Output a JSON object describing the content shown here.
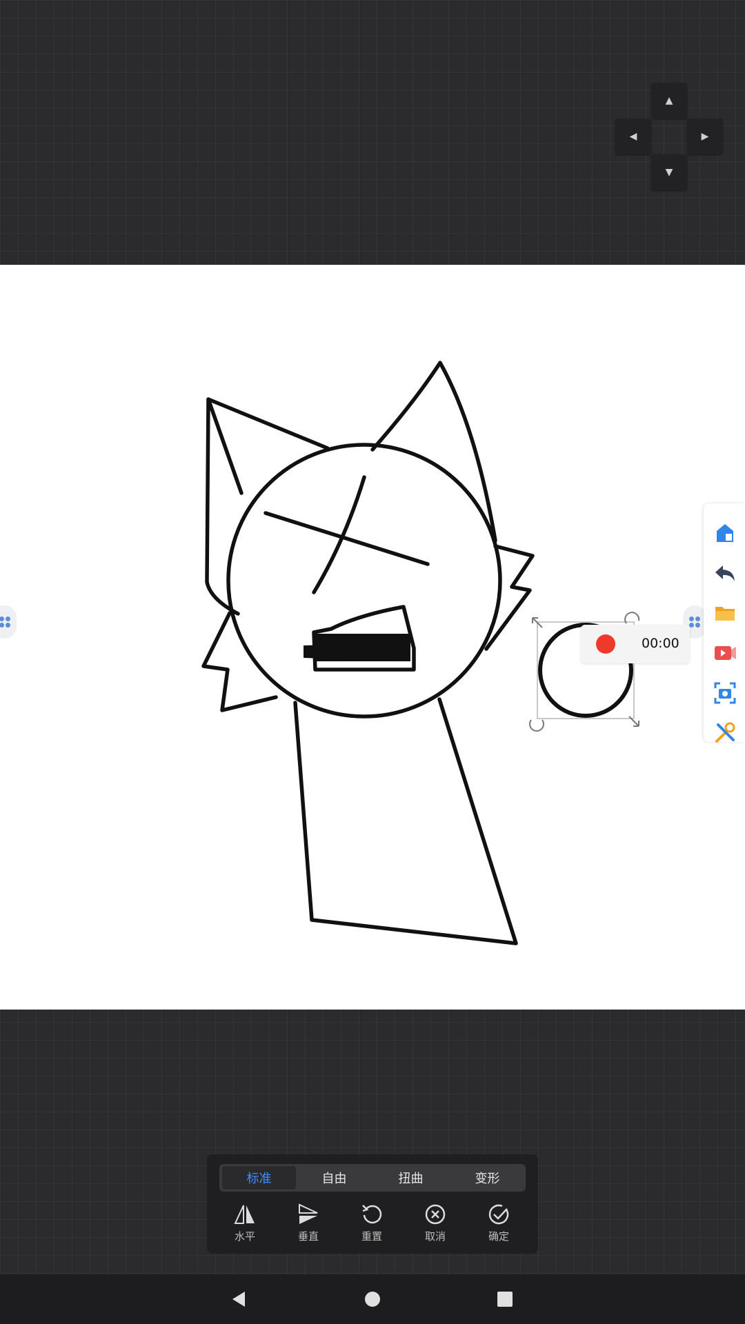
{
  "dpad": {
    "up": "▲",
    "left": "◀",
    "right": "▶",
    "down": "▼"
  },
  "recorder": {
    "time": "00:00",
    "dot_color": "#ee3a2a"
  },
  "right_toolbar": {
    "items": [
      {
        "name": "home-icon"
      },
      {
        "name": "back-arrow-icon"
      },
      {
        "name": "folder-icon"
      },
      {
        "name": "video-record-icon"
      },
      {
        "name": "screenshot-icon"
      },
      {
        "name": "tools-icon"
      }
    ]
  },
  "transform_panel": {
    "tabs": [
      "标准",
      "自由",
      "扭曲",
      "变形"
    ],
    "active_tab": "标准",
    "actions": [
      {
        "label": "水平",
        "icon": "flip-horizontal-icon"
      },
      {
        "label": "垂直",
        "icon": "flip-vertical-icon"
      },
      {
        "label": "重置",
        "icon": "reset-icon"
      },
      {
        "label": "取消",
        "icon": "cancel-icon"
      },
      {
        "label": "确定",
        "icon": "confirm-icon"
      }
    ],
    "accent": "#3f8cff"
  },
  "nav_bar": {
    "back": "back-triangle-icon",
    "home": "home-circle-icon",
    "recents": "recents-square-icon"
  }
}
